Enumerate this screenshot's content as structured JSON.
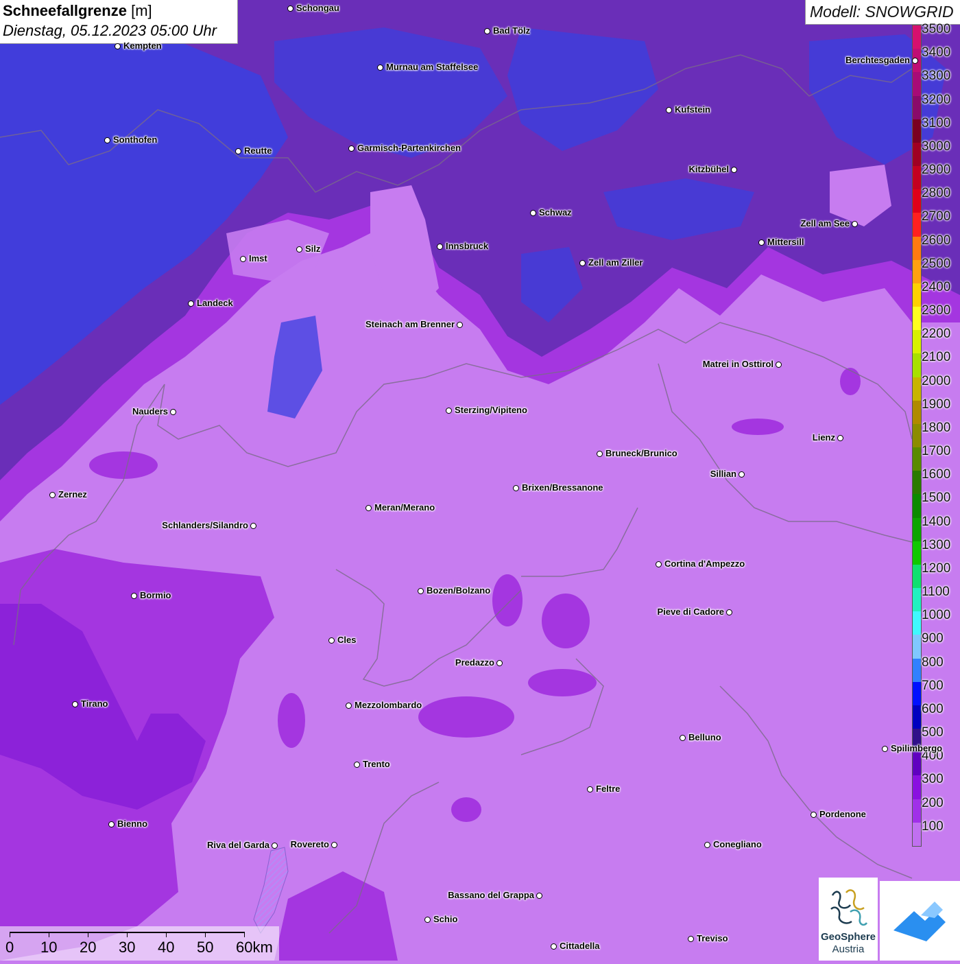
{
  "header": {
    "title": "Schneefallgrenze",
    "unit": "[m]",
    "datetime": "Dienstag, 05.12.2023 05:00 Uhr"
  },
  "model": {
    "label": "Modell: SNOWGRID"
  },
  "legend": {
    "labels": [
      "3500",
      "3400",
      "3300",
      "3200",
      "3100",
      "3000",
      "2900",
      "2800",
      "2700",
      "2600",
      "2500",
      "2400",
      "2300",
      "2200",
      "2100",
      "2000",
      "1900",
      "1800",
      "1700",
      "1600",
      "1500",
      "1400",
      "1300",
      "1200",
      "1100",
      "1000",
      "900",
      "800",
      "700",
      "600",
      "500",
      "400",
      "300",
      "200",
      "100"
    ],
    "colors": [
      "#d6106e",
      "#c00e74",
      "#a80b77",
      "#8a0a6a",
      "#7a0022",
      "#a00022",
      "#c40020",
      "#e0001a",
      "#ff2020",
      "#ff7a10",
      "#ffa010",
      "#ffd000",
      "#ffff20",
      "#d8f000",
      "#a8e000",
      "#c8b400",
      "#b08a00",
      "#8c8c00",
      "#5a8a00",
      "#2a7a00",
      "#0c8a00",
      "#0ca400",
      "#10c800",
      "#10e070",
      "#20f0c0",
      "#40f8ff",
      "#80c8ff",
      "#3080ff",
      "#0010ff",
      "#0000c0",
      "#30108a",
      "#6000c0",
      "#8a10e0",
      "#a030e8",
      "#c070f0"
    ]
  },
  "cities": [
    {
      "name": "Schongau",
      "side": "right"
    },
    {
      "name": "Bad Tölz",
      "side": "right"
    },
    {
      "name": "Kempten",
      "side": "right"
    },
    {
      "name": "Murnau am Staffelsee",
      "side": "right"
    },
    {
      "name": "Kufstein",
      "side": "right"
    },
    {
      "name": "Berchtesgaden",
      "side": "left"
    },
    {
      "name": "Sonthofen",
      "side": "right"
    },
    {
      "name": "Reutte",
      "side": "right"
    },
    {
      "name": "Garmisch-Partenkirchen",
      "side": "right"
    },
    {
      "name": "Kitzbühel",
      "side": "left"
    },
    {
      "name": "Schwaz",
      "side": "right"
    },
    {
      "name": "Zell am See",
      "side": "left"
    },
    {
      "name": "Innsbruck",
      "side": "right"
    },
    {
      "name": "Mittersill",
      "side": "right"
    },
    {
      "name": "Imst",
      "side": "right"
    },
    {
      "name": "Silz",
      "side": "right"
    },
    {
      "name": "Zell am Ziller",
      "side": "right"
    },
    {
      "name": "Landeck",
      "side": "right"
    },
    {
      "name": "Steinach am Brenner",
      "side": "left"
    },
    {
      "name": "Matrei in Osttirol",
      "side": "left"
    },
    {
      "name": "Nauders",
      "side": "left"
    },
    {
      "name": "Sterzing/Vipiteno",
      "side": "right"
    },
    {
      "name": "Lienz",
      "side": "left"
    },
    {
      "name": "Bruneck/Brunico",
      "side": "right"
    },
    {
      "name": "Sillian",
      "side": "left"
    },
    {
      "name": "Zernez",
      "side": "right"
    },
    {
      "name": "Brixen/Bressanone",
      "side": "right"
    },
    {
      "name": "Meran/Merano",
      "side": "right"
    },
    {
      "name": "Schlanders/Silandro",
      "side": "left"
    },
    {
      "name": "Cortina d'Ampezzo",
      "side": "right"
    },
    {
      "name": "Bozen/Bolzano",
      "side": "right"
    },
    {
      "name": "Bormio",
      "side": "right"
    },
    {
      "name": "Pieve di Cadore",
      "side": "left"
    },
    {
      "name": "Cles",
      "side": "right"
    },
    {
      "name": "Predazzo",
      "side": "left"
    },
    {
      "name": "Tirano",
      "side": "right"
    },
    {
      "name": "Mezzolombardo",
      "side": "right"
    },
    {
      "name": "Belluno",
      "side": "right"
    },
    {
      "name": "Spilimbergo",
      "side": "right"
    },
    {
      "name": "Trento",
      "side": "right"
    },
    {
      "name": "Feltre",
      "side": "right"
    },
    {
      "name": "Pordenone",
      "side": "right"
    },
    {
      "name": "Bienno",
      "side": "right"
    },
    {
      "name": "Riva del Garda",
      "side": "left"
    },
    {
      "name": "Rovereto",
      "side": "left"
    },
    {
      "name": "Conegliano",
      "side": "right"
    },
    {
      "name": "Bassano del Grappa",
      "side": "left"
    },
    {
      "name": "Schio",
      "side": "right"
    },
    {
      "name": "Treviso",
      "side": "right"
    },
    {
      "name": "Cittadella",
      "side": "right"
    }
  ],
  "scale": {
    "labels": [
      "0",
      "10",
      "20",
      "30",
      "40",
      "50",
      "60km"
    ]
  },
  "logos": {
    "geosphere_line1": "GeoSphere",
    "geosphere_line2": "Austria",
    "geosphere_icon": "geosphere-logo-icon",
    "app_icon": "snowgrid-app-icon"
  },
  "colors": {
    "dark_blue": "#3a3ce0",
    "dark_purple": "#5a2e9a",
    "purple": "#8a20d8",
    "magenta": "#b028d8",
    "light_lilac": "#c77cf0"
  }
}
